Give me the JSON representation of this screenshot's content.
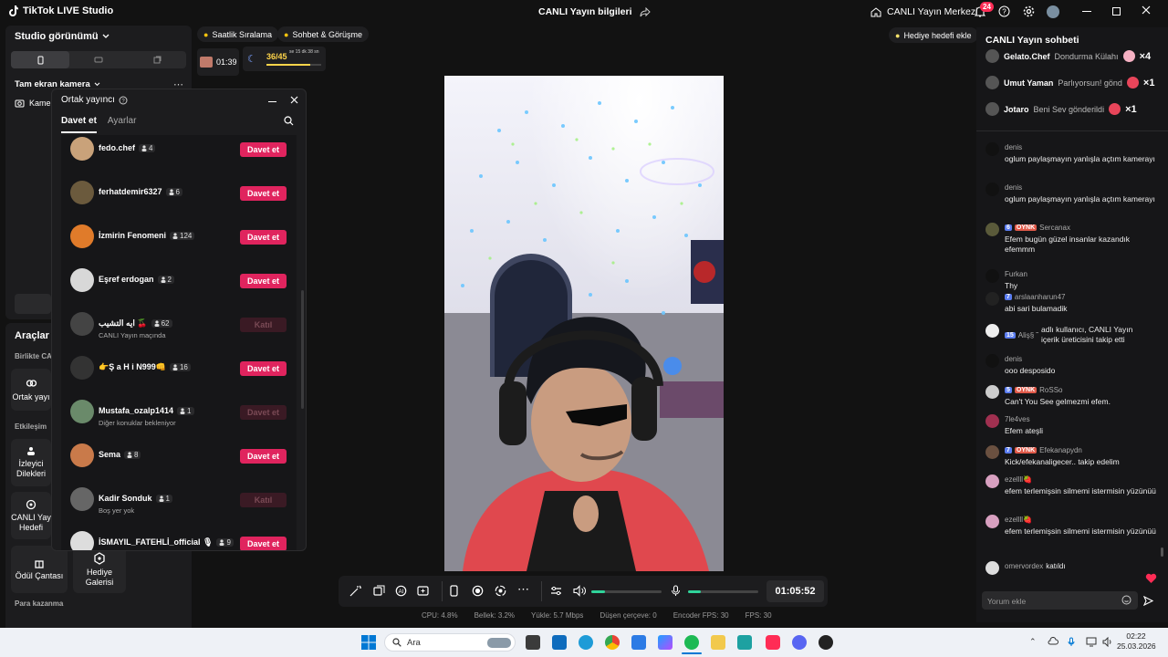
{
  "titlebar": {
    "app_name": "TikTok LIVE Studio",
    "center_title": "CANLI Yayın bilgileri",
    "live_center": "CANLI Yayın Merkezi",
    "notif_count": "24"
  },
  "left": {
    "studio_view": "Studio görünümü",
    "fullscreen_camera": "Tam ekran kamera",
    "camera_label": "Kame",
    "tools_title": "Araçlar",
    "together_label": "Birlikte CA",
    "co_host_tool": "Ortak yayı",
    "interaction_label": "Etkileşim",
    "viewer_wishes": [
      "İzleyici",
      "Dilekleri"
    ],
    "live_goal": [
      "CANLI Yay",
      "Hedefi"
    ],
    "reward_bag": "Ödül Çantası",
    "gift_gallery": [
      "Hediye",
      "Galerisi"
    ],
    "earn_money": "Para kazanma"
  },
  "top": {
    "hourly_rank": "Saatlik Sıralama",
    "chat_meet": "Sohbet & Görüşme",
    "timer": "01:39",
    "progress_text": "36/45",
    "countdown": "se 15 dk 38 sn",
    "add_gift_goal": "Hediye hedefi ekle",
    "goal_progress": 0.8
  },
  "dialog": {
    "title": "Ortak yayıncı",
    "tab_invite": "Davet et",
    "tab_settings": "Ayarlar",
    "rows": [
      {
        "name": "fedo.chef",
        "count": "4",
        "sub": "",
        "action": "Davet et",
        "enabled": true,
        "color": "#c9a27a"
      },
      {
        "name": "ferhatdemir6327",
        "count": "6",
        "sub": "",
        "action": "Davet et",
        "enabled": true,
        "color": "#6b5a3d"
      },
      {
        "name": "İzmirin Fenomeni",
        "count": "124",
        "sub": "",
        "action": "Davet et",
        "enabled": true,
        "color": "#e07b2a"
      },
      {
        "name": "Eşref erdogan",
        "count": "2",
        "sub": "",
        "action": "Davet et",
        "enabled": true,
        "color": "#d8d8d8"
      },
      {
        "name": "ايه التشيب 🍒",
        "count": "62",
        "sub": "CANLI Yayın maçında",
        "action": "Katıl",
        "enabled": false,
        "color": "#444"
      },
      {
        "name": "👉Ş a H i N999👊",
        "count": "16",
        "sub": "",
        "action": "Davet et",
        "enabled": true,
        "color": "#333"
      },
      {
        "name": "Mustafa_ozalp1414",
        "count": "1",
        "sub": "Diğer konuklar bekleniyor",
        "action": "Davet et",
        "enabled": false,
        "color": "#6a8a6a"
      },
      {
        "name": "Sema",
        "count": "8",
        "sub": "",
        "action": "Davet et",
        "enabled": true,
        "color": "#c97a4a"
      },
      {
        "name": "Kadir Sonduk",
        "count": "1",
        "sub": "Boş yer yok",
        "action": "Katıl",
        "enabled": false,
        "color": "#666"
      },
      {
        "name": "İSMAYIL_FATEHLİ_official 🎙",
        "count": "9",
        "sub": "",
        "action": "Davet et",
        "enabled": true,
        "color": "#ddd"
      }
    ]
  },
  "controls": {
    "duration": "01:05:52",
    "volume_level": 0.2,
    "mic_level": 0.18
  },
  "stats": {
    "cpu": "CPU:  4.8%",
    "memory": "Bellek:  3.2%",
    "upload": "Yükle:  5.7 Mbps",
    "dropped": "Düşen çerçeve:  0",
    "encoder_fps": "Encoder FPS:  30",
    "fps": "FPS:  30"
  },
  "chat": {
    "title": "CANLI Yayın sohbeti",
    "gifts": [
      {
        "user": "Gelato.Chef",
        "text": "Dondurma Külahı",
        "mult": "×4"
      },
      {
        "user": "Umut Yaman",
        "text": "Parlıyorsun! gönd",
        "mult": "×1"
      },
      {
        "user": "Jotaro",
        "text": "Beni Sev gönderildi",
        "mult": "×1"
      }
    ],
    "messages": [
      {
        "user": "denis",
        "level": "",
        "tag": "",
        "text": "oglum paylaşmayın yanlışla açtım kamerayı"
      },
      {
        "user": "denis",
        "level": "",
        "tag": "",
        "text": "oglum paylaşmayın yanlışla açtım kamerayı"
      },
      {
        "user": "Sercanax",
        "level": "6",
        "tag": "OYNK",
        "text": "Efem bugün güzel insanlar kazandık efemmm"
      },
      {
        "user": "Furkan",
        "level": "",
        "tag": "",
        "text": "Thy"
      },
      {
        "user": "arslaanharun47",
        "level": "7",
        "tag": "",
        "text": "abi sari bulamadik"
      },
      {
        "user": "Aliş§ ˜",
        "level": "15",
        "tag": "",
        "text": "adlı kullanıcı, CANLI Yayın içerik üreticisini takip etti"
      },
      {
        "user": "denis",
        "level": "",
        "tag": "",
        "text": "ooo desposido"
      },
      {
        "user": "RoSSo",
        "level": "5",
        "tag": "OYNK",
        "text": "Can't You See gelmezmi efem."
      },
      {
        "user": "7le4ves",
        "level": "",
        "tag": "",
        "text": "Efem ateşli"
      },
      {
        "user": "Efekanapydn",
        "level": "7",
        "tag": "OYNK",
        "text": "Kick/efekanaligecer.. takip edelim"
      },
      {
        "user": "ezellll🍓",
        "level": "",
        "tag": "",
        "text": "efem terlemişsin silmemi istermisin yüzünüü"
      },
      {
        "user": "ezellll🍓",
        "level": "",
        "tag": "",
        "text": "efem terlemişsin silmemi istermisin yüzünüü"
      },
      {
        "user": "omervordex",
        "level": "",
        "tag": "",
        "text": "katıldı"
      }
    ],
    "input_placeholder": "Yorum ekle"
  },
  "taskbar": {
    "search": "Ara",
    "time": "02:22",
    "date": "25.03.2026"
  }
}
